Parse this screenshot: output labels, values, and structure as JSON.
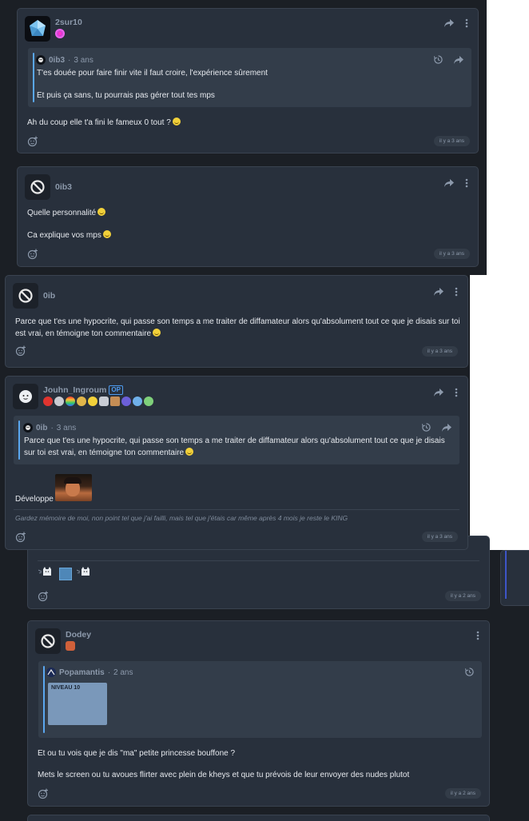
{
  "colors": {
    "background": "#1b1f25",
    "card": "#28303c",
    "quote_bar": "#5aa7f0",
    "username": "#8c99ab",
    "text": "#e6e9ee"
  },
  "icons": {
    "share": "share-icon",
    "more": "more-vertical-icon",
    "history": "history-icon",
    "reply": "reply-icon",
    "react": "add-reaction-icon",
    "banned": "banned-avatar-icon"
  },
  "posts": [
    {
      "username": "2sur10",
      "quote": {
        "author": "0ib3",
        "age": "3 ans",
        "line1": "T'es douée pour faire finir vite il faut croire, l'expérience sûrement",
        "line2": "Et puis ça sans, tu pourrais pas gérer tout tes mps"
      },
      "body": "Ah du coup elle t'a fini le fameux 0 tout ?",
      "timestamp": "il y a 3 ans"
    },
    {
      "username": "0ib3",
      "body1": "Quelle personnalité",
      "body2": "Ca explique vos mps",
      "timestamp": "il y a 3 ans"
    },
    {
      "username": "0ib",
      "body": "Parce que t'es une hypocrite, qui passe son temps a me traiter de diffamateur alors qu'absolument tout ce que je disais sur toi est vrai, en témoigne ton commentaire",
      "timestamp": "il y a 3 ans"
    },
    {
      "username": "Jouhn_Ingroum",
      "op_badge": "OP",
      "quote": {
        "author": "0ib",
        "age": "3 ans",
        "text": "Parce que t'es une hypocrite, qui passe son temps a me traiter de diffamateur alors qu'absolument tout ce que je disais sur toi est vrai, en témoigne ton commentaire"
      },
      "body": "Développe",
      "signature": "Gardez mémoire de moi, non point tel que j'ai failli, mais tel que j'étais car même après 4 mois je reste le KING",
      "timestamp": "il y a 3 ans"
    },
    {
      "timestamp": "il y a 2 ans"
    },
    {
      "username": "Dodey",
      "quote": {
        "author": "Popamantis",
        "age": "2 ans",
        "image_text": "NIVEAU 10"
      },
      "body1": "Et ou tu vois que je dis \"ma\" petite princesse bouffone ?",
      "body2": "Mets le screen ou tu avoues flirter avec plein de kheys et que tu prévois de leur envoyer des nudes plutot",
      "timestamp": "il y a 2 ans"
    }
  ]
}
